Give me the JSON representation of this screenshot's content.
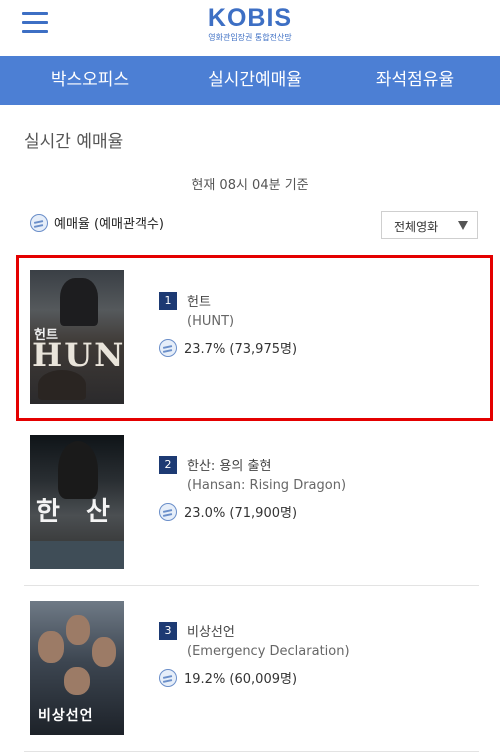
{
  "header": {
    "logo_text": "KOBIS",
    "logo_subtitle": "영화관입장권 통합전산망"
  },
  "nav": {
    "items": [
      {
        "label": "박스오피스"
      },
      {
        "label": "실시간예매율"
      },
      {
        "label": "좌석점유율"
      }
    ]
  },
  "page": {
    "title": "실시간 예매율",
    "base_time": "현재 08시 04분  기준",
    "rate_label": "예매율 (예매관객수)",
    "filter": {
      "selected": "전체영화"
    }
  },
  "movies": [
    {
      "rank": "1",
      "title": "헌트",
      "en_title": "(HUNT)",
      "rate": "23.7% (73,975명)",
      "poster_text": "HUNT",
      "poster_kr": "헌트"
    },
    {
      "rank": "2",
      "title": "한산: 용의 출현",
      "en_title": "(Hansan: Rising Dragon)",
      "rate": "23.0% (71,900명)",
      "poster_han": "한",
      "poster_san": "산"
    },
    {
      "rank": "3",
      "title": "비상선언",
      "en_title": "(Emergency Declaration)",
      "rate": "19.2% (60,009명)",
      "poster_text": "비상선언"
    }
  ],
  "colors": {
    "brand": "#3d6fc4",
    "nav_bg": "#4c7fd4",
    "rank_badge": "#1d3a73",
    "highlight": "#e40000"
  }
}
